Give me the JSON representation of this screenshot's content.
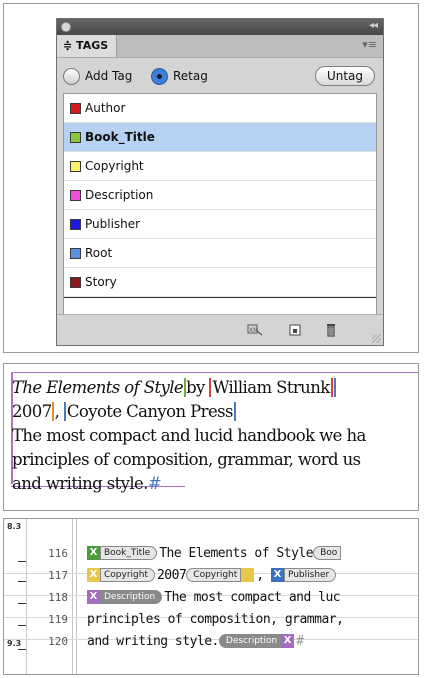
{
  "panel": {
    "collapse_glyph": "◂◂",
    "tab_label": "≑ TAGS",
    "menu_glyph": "▾≡",
    "add_tag_label": "Add Tag",
    "retag_label": "Retag",
    "untag_label": "Untag",
    "selected_mode": "Retag",
    "tags": [
      {
        "label": "Author",
        "color": "#d41a1a",
        "selected": false
      },
      {
        "label": "Book_Title",
        "color": "#8cc63f",
        "selected": true
      },
      {
        "label": "Copyright",
        "color": "#fdf16a",
        "selected": false
      },
      {
        "label": "Description",
        "color": "#ea4fd6",
        "selected": false
      },
      {
        "label": "Publisher",
        "color": "#1a1ae0",
        "selected": false
      },
      {
        "label": "Root",
        "color": "#5b8fe0",
        "selected": false
      },
      {
        "label": "Story",
        "color": "#8b1a1a",
        "selected": false
      }
    ],
    "footer_icons": [
      "tag-autotag-icon",
      "new-tag-icon",
      "delete-tag-icon"
    ]
  },
  "story": {
    "line1_title": "The Elements of Style",
    "line1_by": "by ",
    "line1_author": "William Strunk",
    "line2_year": "2007",
    "line2_comma": ", ",
    "line2_publisher": "Coyote Canyon Press",
    "line3": "The most compact and lucid handbook we ha",
    "line4": "principles of composition, grammar, word us",
    "line5": "and writing style.",
    "end_mark": "#"
  },
  "editor": {
    "depth_top": "8.3",
    "depth_bottom": "9.3",
    "line_numbers": [
      "116",
      "117",
      "118",
      "119",
      "120"
    ],
    "tag_x": "X",
    "l116_tag": "Book_Title",
    "l116_text": "The Elements of Style",
    "l116_close": "Boo",
    "l117_tag": "Copyright",
    "l117_text": "2007",
    "l117_close": "Copyright",
    "l117_comma": ",",
    "l117_tag2": "Publisher",
    "l118_tag": "Description",
    "l118_text": "The most compact and luc",
    "l119_text": "principles of composition, grammar,",
    "l120_text": "and writing style.",
    "l120_close": "Description",
    "l120_end": "#"
  }
}
